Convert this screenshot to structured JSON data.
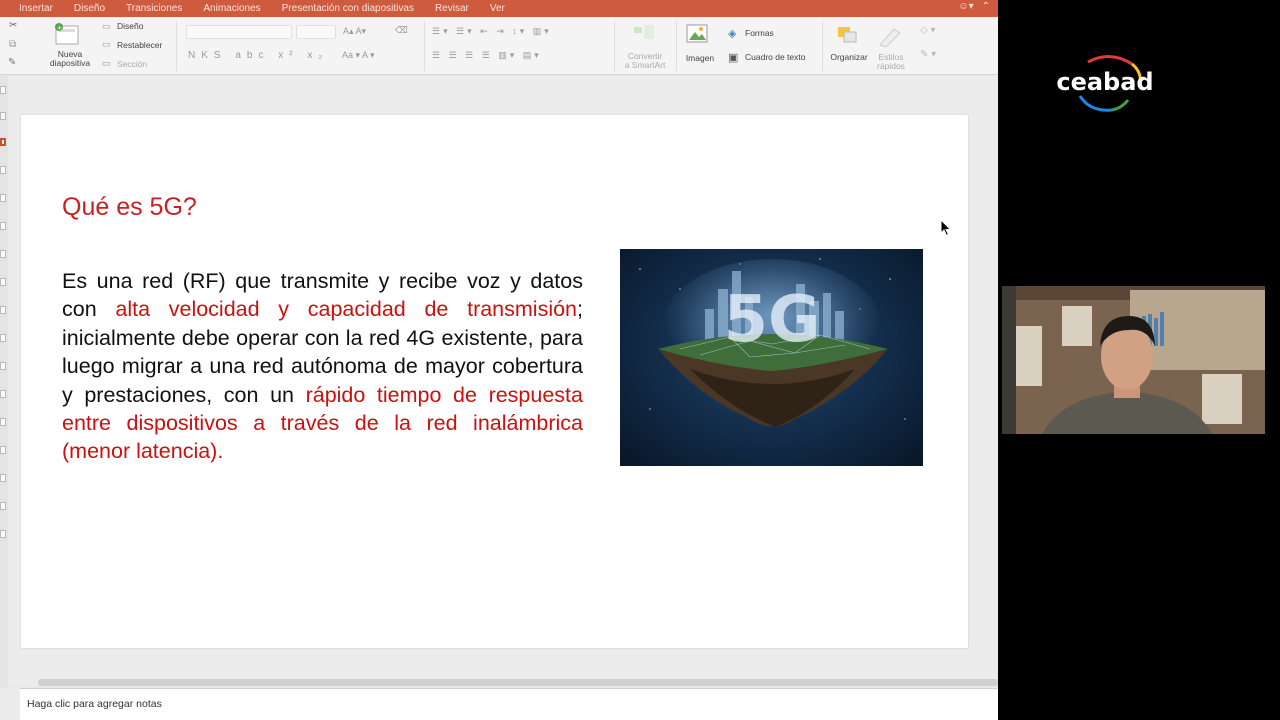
{
  "ribbon_tabs": [
    "Insertar",
    "Diseño",
    "Transiciones",
    "Animaciones",
    "Presentación con diapositivas",
    "Revisar",
    "Ver"
  ],
  "ribbon": {
    "new_slide_line1": "Nueva",
    "new_slide_line2": "diapositiva",
    "layout": "Diseño",
    "reset": "Restablecer",
    "section": "Sección",
    "convert_line1": "Convertir",
    "convert_line2": "a SmartArt",
    "image": "Imagen",
    "shapes": "Formas",
    "textbox": "Cuadro de texto",
    "arrange": "Organizar",
    "quick_styles_line1": "Estilos",
    "quick_styles_line2": "rápidos"
  },
  "slide": {
    "title": "Qué es 5G?",
    "body": [
      {
        "text": "Es una red (RF) que transmite y recibe voz y datos con ",
        "red": false
      },
      {
        "text": "alta velocidad y capacidad de transmisión",
        "red": true
      },
      {
        "text": "; inicialmente debe operar con la red 4G existente, para luego migrar a una red autónoma de mayor cobertura y prestaciones, con un ",
        "red": false
      },
      {
        "text": "rápido tiempo de respuesta entre dispositivos a través de la red inalámbrica (menor latencia).",
        "red": true
      }
    ],
    "image_text": "5G"
  },
  "notes_placeholder": "Haga clic para agregar notas",
  "brand": {
    "logo_text": "ceabad"
  },
  "colors": {
    "ribbon_tab_bar": "#cf5b3f",
    "title_red": "#cc1f1f",
    "body_red": "#cc1010"
  }
}
